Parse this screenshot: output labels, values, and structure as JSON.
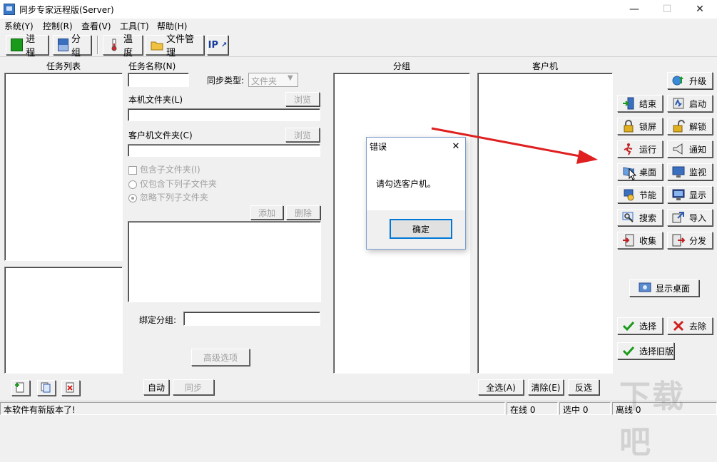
{
  "window": {
    "title": "同步专家远程版(Server)",
    "min": "—",
    "max": "☐",
    "close": "✕"
  },
  "menu": [
    "系统(Y)",
    "控制(R)",
    "查看(V)",
    "工具(T)",
    "帮助(H)"
  ],
  "toolbar": {
    "progress": "进程",
    "group": "分组",
    "temperature": "温度",
    "file_manager": "文件管理",
    "ip": "IP"
  },
  "task_list": {
    "header": "任务列表"
  },
  "task_form": {
    "name_label": "任务名称(N)",
    "name_value": "",
    "sync_type_label": "同步类型:",
    "sync_type_value": "文件夹",
    "local_folder_label": "本机文件夹(L)",
    "local_folder_value": "",
    "browse": "浏览",
    "client_folder_label": "客户机文件夹(C)",
    "client_folder_value": "",
    "include_sub_label": "包含子文件夹(I)",
    "only_include_label": "仅包含下列子文件夹",
    "ignore_label": "忽略下列子文件夹",
    "add": "添加",
    "delete": "删除",
    "bind_group_label": "绑定分组:",
    "bind_group_value": "",
    "advanced": "高级选项"
  },
  "group_panel": {
    "header": "分组"
  },
  "client_panel": {
    "header": "客户机"
  },
  "right_buttons": {
    "upgrade": "升级",
    "end": "结束",
    "start": "启动",
    "lock": "锁屏",
    "unlock": "解锁",
    "run": "运行",
    "notify": "通知",
    "desktop": "桌面",
    "monitor": "监视",
    "power": "节能",
    "display": "显示",
    "search": "搜索",
    "import": "导入",
    "collect": "收集",
    "distribute": "分发",
    "show_desktop": "显示桌面",
    "select": "选择",
    "remove": "去除",
    "select_old": "选择旧版"
  },
  "bottom_buttons": {
    "auto": "自动",
    "sync": "同步",
    "select_all": "全选(A)",
    "clear": "清除(E)",
    "invert": "反选"
  },
  "status": {
    "message": "本软件有新版本了!",
    "online": "在线 0",
    "selected": "选中 0",
    "offline": "离线 0"
  },
  "dialog": {
    "title": "错误",
    "message": "请勾选客户机。",
    "ok": "确定",
    "close": "✕"
  },
  "colors": {
    "arrow": "#e02020",
    "accent": "#0078d7"
  }
}
